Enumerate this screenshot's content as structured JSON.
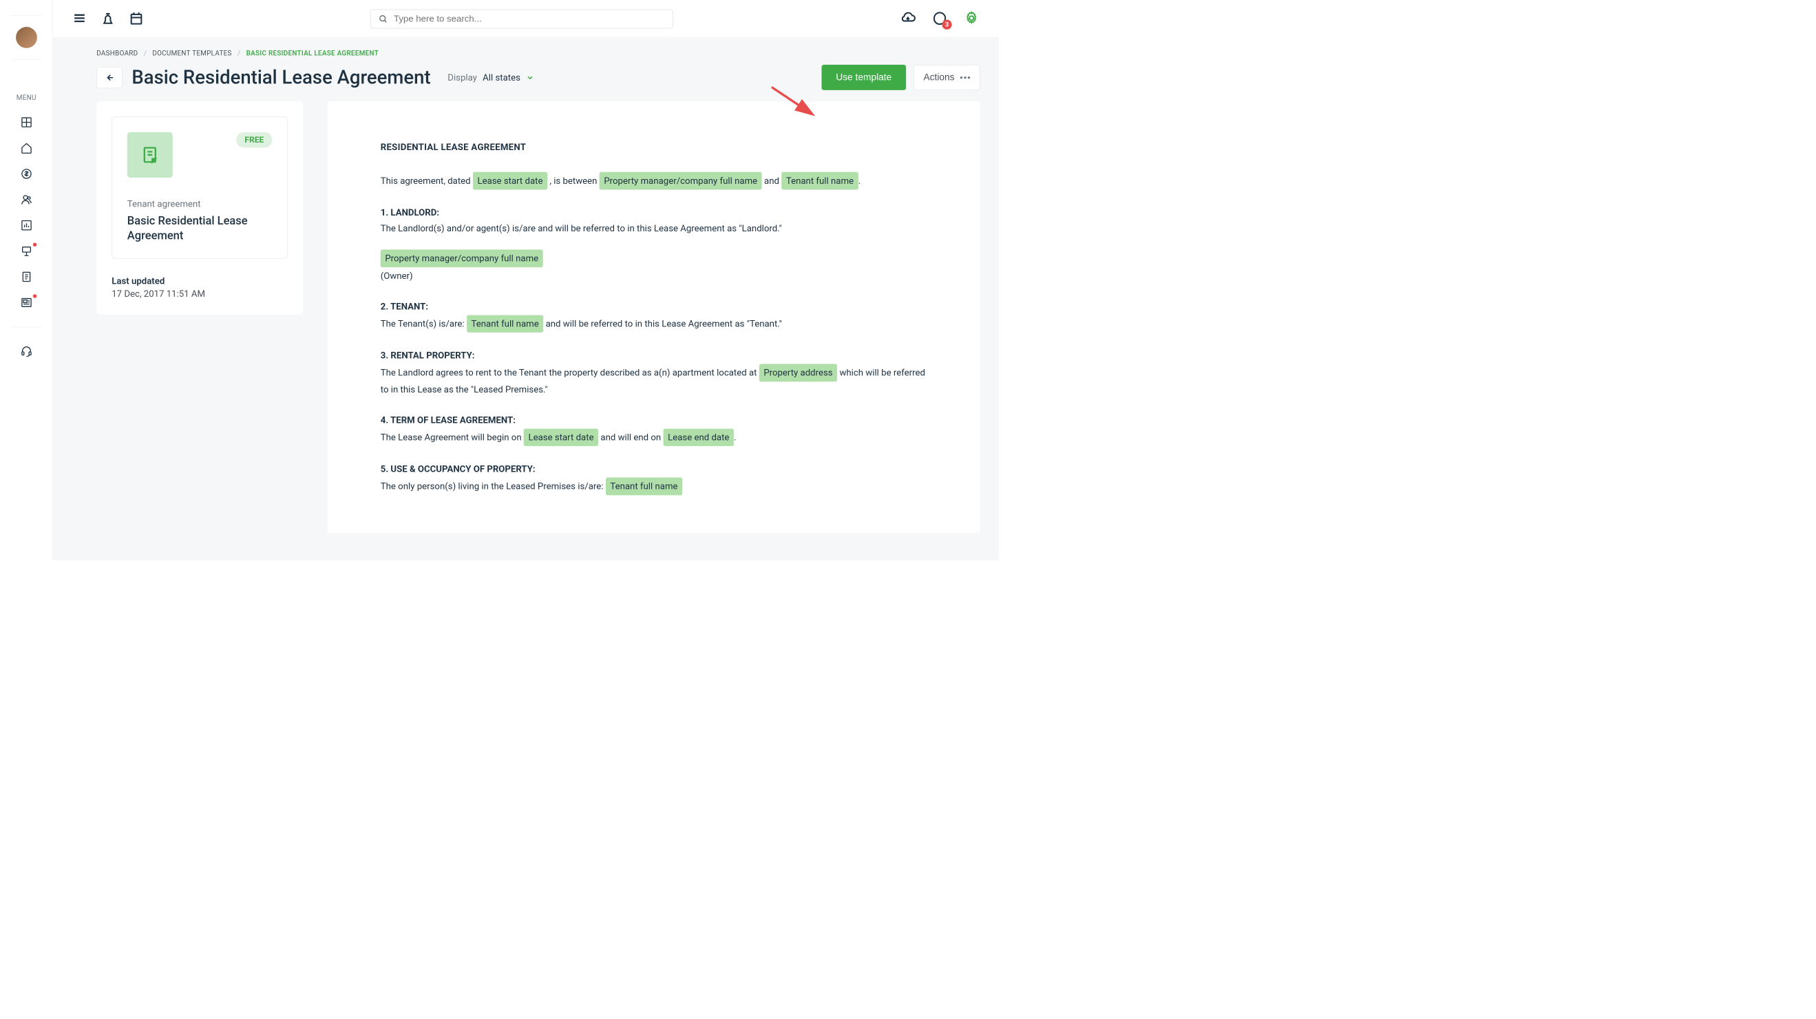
{
  "header": {
    "search_placeholder": "Type here to search...",
    "chat_badge": "3"
  },
  "sidebar": {
    "menu_label": "MENU"
  },
  "breadcrumb": {
    "items": [
      "DASHBOARD",
      "DOCUMENT TEMPLATES",
      "BASIC RESIDENTIAL LEASE AGREEMENT"
    ]
  },
  "page": {
    "title": "Basic Residential Lease Agreement",
    "display_label": "Display",
    "display_value": "All states",
    "use_template_label": "Use template",
    "actions_label": "Actions"
  },
  "template_card": {
    "badge": "FREE",
    "subtitle": "Tenant agreement",
    "title": "Basic Residential Lease Agreement",
    "last_updated_label": "Last updated",
    "last_updated_value": "17 Dec, 2017 11:51 AM"
  },
  "document": {
    "title": "RESIDENTIAL LEASE AGREEMENT",
    "intro_a": "This agreement, dated ",
    "intro_b": ", is between ",
    "intro_c": " and ",
    "p1": "Lease start date",
    "p2": "Property manager/company full name",
    "p3": "Tenant full name",
    "sec1_heading": "1. LANDLORD:",
    "sec1_text": "The Landlord(s) and/or agent(s) is/are and will be referred to in this Lease Agreement as \"Landlord.\"",
    "p4": "Property manager/company full name",
    "sec1_owner": "(Owner)",
    "sec2_heading": "2. TENANT:",
    "sec2_a": "The Tenant(s) is/are: ",
    "sec2_b": " and will be referred to in this Lease Agreement as \"Tenant.\"",
    "p5": "Tenant full name",
    "sec3_heading": "3. RENTAL PROPERTY:",
    "sec3_a": "The Landlord agrees to rent to the Tenant the property described as a(n) apartment located at ",
    "sec3_b": " which will be referred to in this Lease as the \"Leased Premises.\"",
    "p6": "Property address",
    "sec4_heading": "4. TERM OF LEASE AGREEMENT:",
    "sec4_a": "The Lease Agreement will begin on ",
    "sec4_b": " and will end on ",
    "p7": "Lease start date",
    "p8": "Lease end date",
    "sec5_heading": "5. USE & OCCUPANCY OF PROPERTY:",
    "sec5_a": "The only person(s) living in the Leased Premises is/are: ",
    "p9": "Tenant full name"
  }
}
